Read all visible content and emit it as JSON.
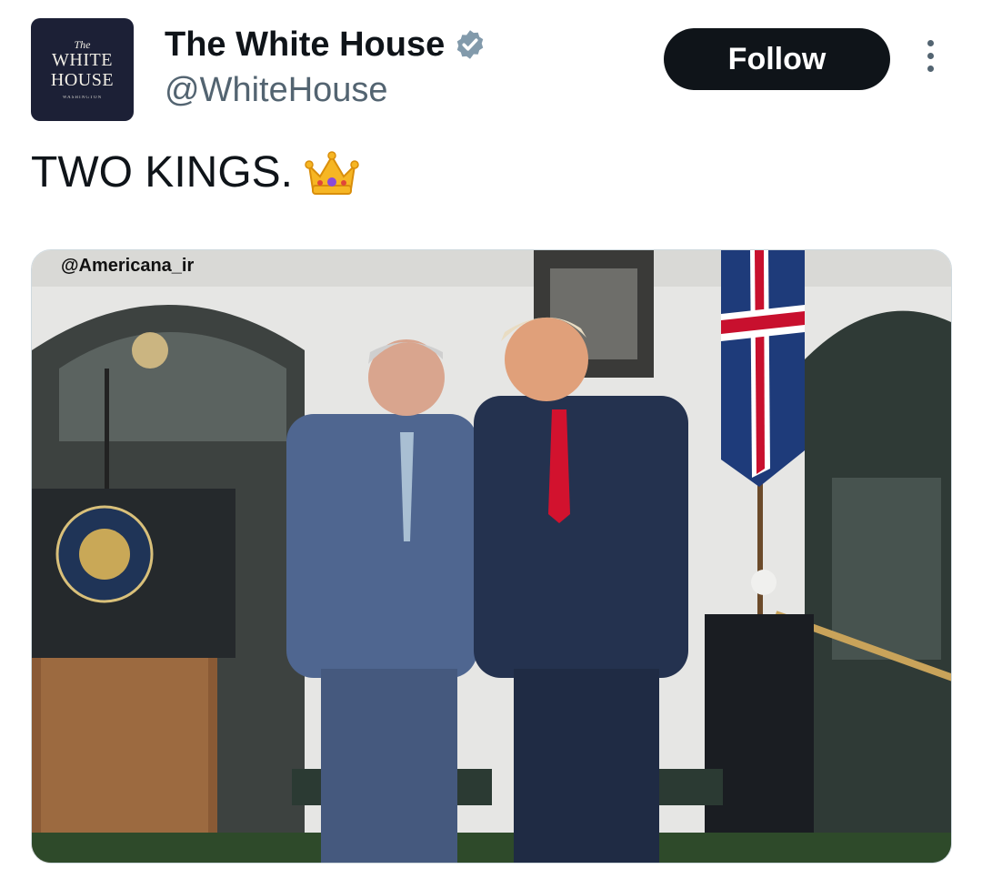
{
  "author": {
    "display_name": "The White House",
    "handle": "@WhiteHouse",
    "verified": true,
    "avatar": {
      "line1": "The",
      "line2": "WHITE",
      "line3": "HOUSE",
      "line4": "WASHINGTON"
    }
  },
  "follow_label": "Follow",
  "tweet": {
    "text": "TWO KINGS.",
    "emoji": "crown-icon"
  },
  "media": {
    "watermark": "@Americana_ir",
    "description_icon": "photo"
  },
  "colors": {
    "follow_bg": "#0f1419",
    "handle": "#536471",
    "verified": "#829aab"
  }
}
